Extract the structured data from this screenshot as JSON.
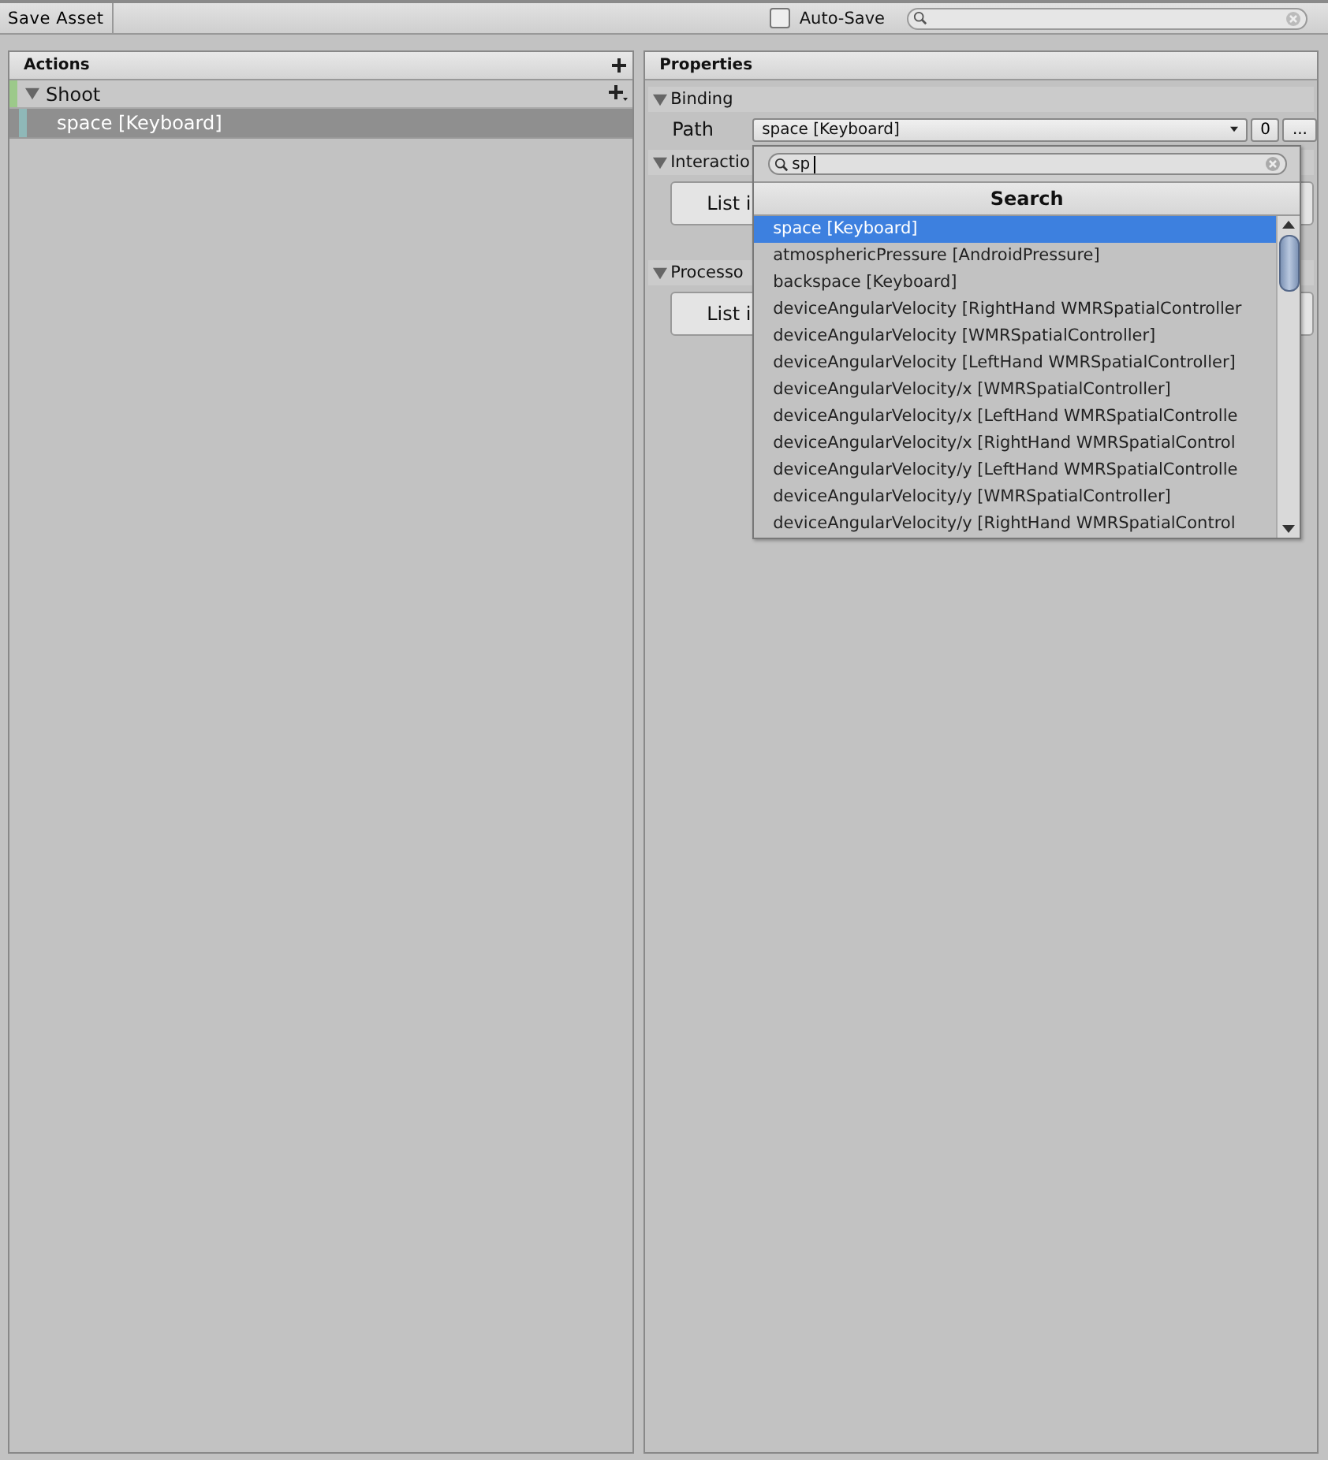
{
  "toolbar": {
    "save_button": "Save Asset",
    "auto_save": {
      "label": "Auto-Save",
      "checked": false
    }
  },
  "actions_panel": {
    "title": "Actions",
    "maps": [
      {
        "name": "Shoot",
        "expanded": true,
        "color": "#9cc98a",
        "bindings": [
          {
            "label": "space [Keyboard]",
            "selected": true,
            "color": "#8fb8b8"
          }
        ]
      }
    ]
  },
  "properties_panel": {
    "title": "Properties",
    "sections": [
      {
        "title": "Binding",
        "expanded": true,
        "kind": "path",
        "label": "Path",
        "value": "space [Keyboard]",
        "count": "0",
        "more": "..."
      },
      {
        "title": "Interactio",
        "expanded": true,
        "kind": "list",
        "button": "List i"
      },
      {
        "title": "Processo",
        "expanded": true,
        "kind": "list",
        "button": "List i"
      }
    ]
  },
  "path_dropdown": {
    "search_value": "sp",
    "header": "Search",
    "items": [
      {
        "label": "space [Keyboard]",
        "selected": true
      },
      {
        "label": "atmosphericPressure [AndroidPressure]",
        "selected": false
      },
      {
        "label": "backspace [Keyboard]",
        "selected": false
      },
      {
        "label": "deviceAngularVelocity [RightHand WMRSpatialController",
        "selected": false
      },
      {
        "label": "deviceAngularVelocity [WMRSpatialController]",
        "selected": false
      },
      {
        "label": "deviceAngularVelocity [LeftHand WMRSpatialController]",
        "selected": false
      },
      {
        "label": "deviceAngularVelocity/x [WMRSpatialController]",
        "selected": false
      },
      {
        "label": "deviceAngularVelocity/x [LeftHand WMRSpatialControlle",
        "selected": false
      },
      {
        "label": "deviceAngularVelocity/x [RightHand WMRSpatialControl",
        "selected": false
      },
      {
        "label": "deviceAngularVelocity/y [LeftHand WMRSpatialControlle",
        "selected": false
      },
      {
        "label": "deviceAngularVelocity/y [WMRSpatialController]",
        "selected": false
      },
      {
        "label": "deviceAngularVelocity/y [RightHand WMRSpatialControl",
        "selected": false
      }
    ]
  }
}
